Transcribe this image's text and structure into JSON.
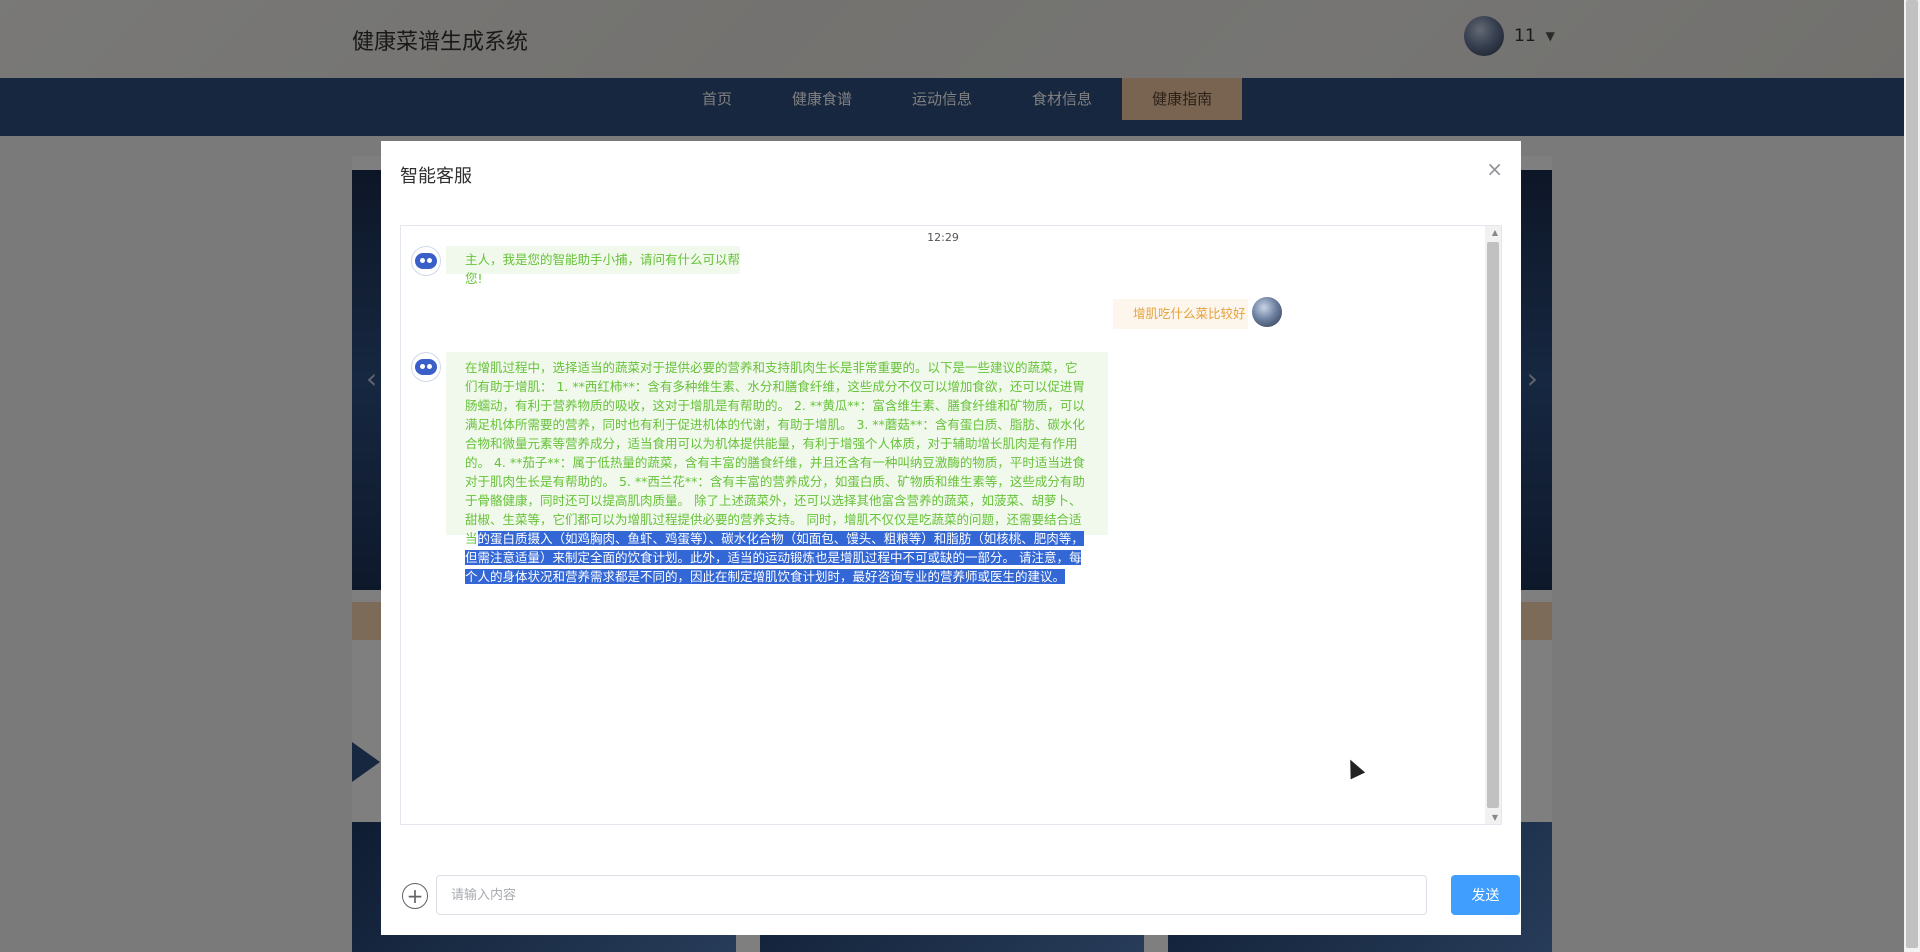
{
  "header": {
    "site_title": "健康菜谱生成系统",
    "user_name": "11"
  },
  "nav": {
    "items": [
      "首页",
      "健康食谱",
      "运动信息",
      "食材信息",
      "健康指南"
    ],
    "active_index": 4
  },
  "modal": {
    "title": "智能客服",
    "close": "×",
    "timestamp": "12:29",
    "messages": [
      {
        "role": "bot",
        "text": "主人，我是您的智能助手小捕，请问有什么可以帮您!"
      },
      {
        "role": "user",
        "text": "增肌吃什么菜比较好"
      },
      {
        "role": "bot",
        "text_normal": "在增肌过程中，选择适当的蔬菜对于提供必要的营养和支持肌肉生长是非常重要的。以下是一些建议的蔬菜，它们有助于增肌： 1. **西红柿**：含有多种维生素、水分和膳食纤维，这些成分不仅可以增加食欲，还可以促进胃肠蠕动，有利于营养物质的吸收，这对于增肌是有帮助的。 2. **黄瓜**：富含维生素、膳食纤维和矿物质，可以满足机体所需要的营养，同时也有利于促进机体的代谢，有助于增肌。 3. **蘑菇**：含有蛋白质、脂肪、碳水化合物和微量元素等营养成分，适当食用可以为机体提供能量，有利于增强个人体质，对于辅助增长肌肉是有作用的。 4. **茄子**：属于低热量的蔬菜，含有丰富的膳食纤维，并且还含有一种叫纳豆激酶的物质，平时适当进食对于肌肉生长是有帮助的。 5. **西兰花**：含有丰富的营养成分，如蛋白质、矿物质和维生素等，这些成分有助于骨骼健康，同时还可以提高肌肉质量。 除了上述蔬菜外，还可以选择其他富含营养的蔬菜，如菠菜、胡萝卜、甜椒、生菜等，它们都可以为增肌过程提供必要的营养支持。 同时，增肌不仅仅是吃蔬菜的问题，还需要结合适当",
        "text_highlight": "的蛋白质摄入（如鸡胸肉、鱼虾、鸡蛋等）、碳水化合物（如面包、馒头、粗粮等）和脂肪（如核桃、肥肉等，但需注意适量）来制定全面的饮食计划。此外，适当的运动锻炼也是增肌过程中不可或缺的一部分。 请注意，每个人的身体状况和营养需求都是不同的，因此在制定增肌饮食计划时，最好咨询专业的营养师或医生的建议。"
      }
    ],
    "input_placeholder": "请输入内容",
    "add_icon": "+",
    "send_label": "发送"
  },
  "icons": {
    "user_caret": "▼",
    "banner_prev": "‹",
    "banner_next": "›",
    "scroll_up": "▲",
    "scroll_down": "▼"
  },
  "colors": {
    "nav_bg": "#2f4f7f",
    "nav_active": "#f0c9a0",
    "bot_bubble": "#f0f9eb",
    "bot_text": "#67c23a",
    "user_bubble": "#fdf6ec",
    "user_text": "#e6a23c",
    "send_button": "#409eff",
    "selection": "#3367d6"
  }
}
